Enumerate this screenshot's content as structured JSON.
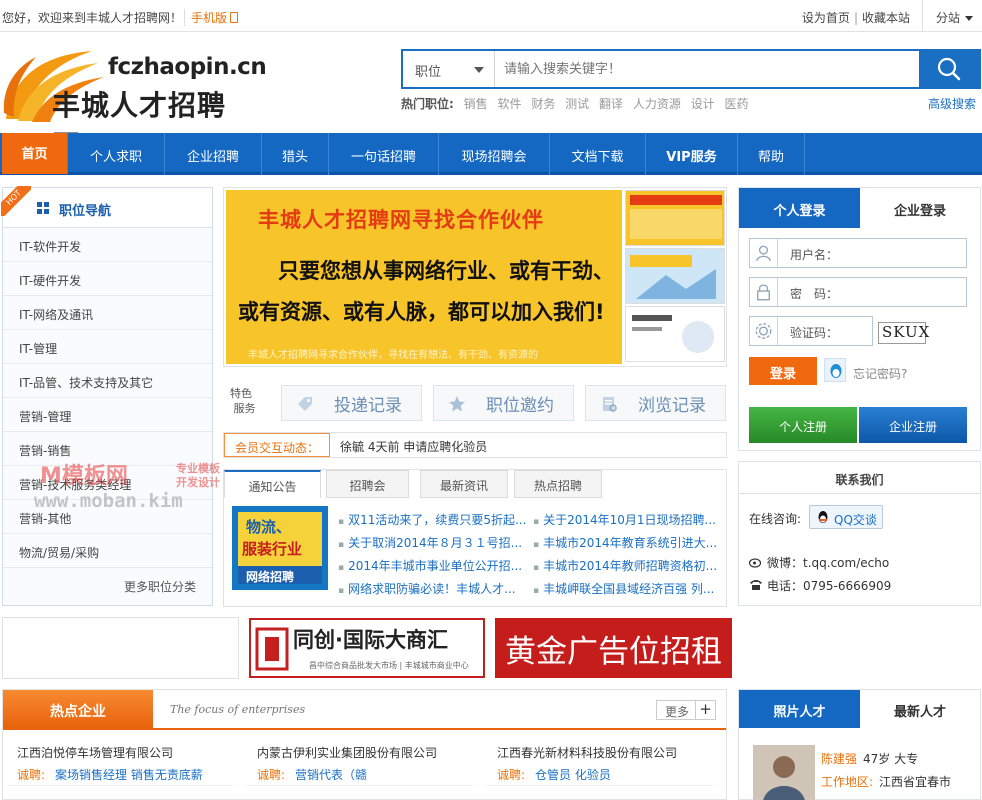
{
  "topbar": {
    "welcome": "您好，欢迎来到丰城人才招聘网！",
    "mobile": "手机版",
    "set_home": "设为首页",
    "bookmark": "收藏本站",
    "branch": "分站"
  },
  "logo": {
    "domain": "fczhaopin.cn",
    "name": "丰城人才招聘网"
  },
  "search": {
    "type": "职位",
    "placeholder": "请输入搜索关键字！",
    "hot_label": "热门职位:",
    "hot": [
      "销售",
      "软件",
      "财务",
      "测试",
      "翻译",
      "人力资源",
      "设计",
      "医药"
    ],
    "advanced": "高级搜索"
  },
  "nav": [
    "首页",
    "个人求职",
    "企业招聘",
    "猎头",
    "一句话招聘",
    "现场招聘会",
    "文档下载",
    "VIP服务",
    "帮助"
  ],
  "sidebar": {
    "ribbon": "HOT",
    "title": "职位导航",
    "items": [
      "IT-软件开发",
      "IT-硬件开发",
      "IT-网络及通讯",
      "IT-管理",
      "IT-品管、技术支持及其它",
      "营销-管理",
      "营销-销售",
      "营销-技术服务类经理",
      "营销-其他",
      "物流/贸易/采购"
    ],
    "more": "更多职位分类"
  },
  "banner": {
    "title": "丰城人才招聘网寻找合作伙伴",
    "line1": "只要您想从事网络行业、或有干劲、",
    "line2": "或有资源、或有人脉，都可以加入我们!",
    "line3": "丰城人才招聘网寻求合作伙伴，寻找在有想法、有干劲、有资源的"
  },
  "quick": {
    "label_a": "特色",
    "label_b": "服务",
    "btn1": "投递记录",
    "btn2": "职位邀约",
    "btn3": "浏览记录"
  },
  "activity": {
    "label": "会员交互动态：",
    "text": "徐毓 4天前 申请应聘化验员"
  },
  "tabs": [
    "通知公告",
    "招聘会",
    "最新资讯",
    "热点招聘"
  ],
  "promo": {
    "l1": "物流、",
    "l2": "服装行业",
    "l3": "网络招聘"
  },
  "news_left": [
    "双11活动来了，续费只要5折起...",
    "关于取消2014年８月３１号招...",
    "2014年丰城市事业单位公开招...",
    "网络求职防骗必读！丰城人才..."
  ],
  "news_right": [
    "关于2014年10月1日现场招聘...",
    "丰城市2014年教育系统引进大...",
    "丰城市2014年教师招聘资格初...",
    "丰城岬联全国县域经济百强 列..."
  ],
  "login": {
    "tab_personal": "个人登录",
    "tab_company": "企业登录",
    "username": "用户名：",
    "password": "密　码：",
    "captcha_label": "验证码：",
    "captcha": "SKUX",
    "submit": "登录",
    "forgot": "忘记密码?",
    "reg_personal": "个人注册",
    "reg_company": "企业注册"
  },
  "contact": {
    "title": "联系我们",
    "online": "在线咨询:",
    "qq": "QQ交谈",
    "weibo": "微博：t.qq.com/echo",
    "phone": "电话：0795-6666909"
  },
  "ads": {
    "ad1_title": "同创·国际大商汇",
    "ad1_sub": "昌中综合商品批发大市场 | 丰城城市商业中心",
    "ad2_title": "黄金广告位招租"
  },
  "hot_companies": {
    "title": "热点企业",
    "subtitle": "The focus of enterprises",
    "more": "更多",
    "plus": "+",
    "hire_label": "诚聘:",
    "items": [
      {
        "name": "江西泊悦停车场管理有限公司",
        "jobs": "案场销售经理 销售无责底薪"
      },
      {
        "name": "内蒙古伊利实业集团股份有限公司",
        "jobs": "营销代表（赣"
      },
      {
        "name": "江西春光新材料科技股份有限公司",
        "jobs": "仓管员 化验员"
      }
    ]
  },
  "talent": {
    "tab_photo": "照片人才",
    "tab_latest": "最新人才",
    "name": "陈建强",
    "info": "47岁 大专",
    "loc_label": "工作地区:",
    "loc": "江西省宜春市"
  },
  "watermark": {
    "a": "模板网",
    "b1": "专业模板",
    "b2": "开发设计",
    "c": "www.moban.kim"
  },
  "colors": {
    "primary": "#1468c2",
    "accent": "#f0690f",
    "green": "#2f9a2f"
  }
}
